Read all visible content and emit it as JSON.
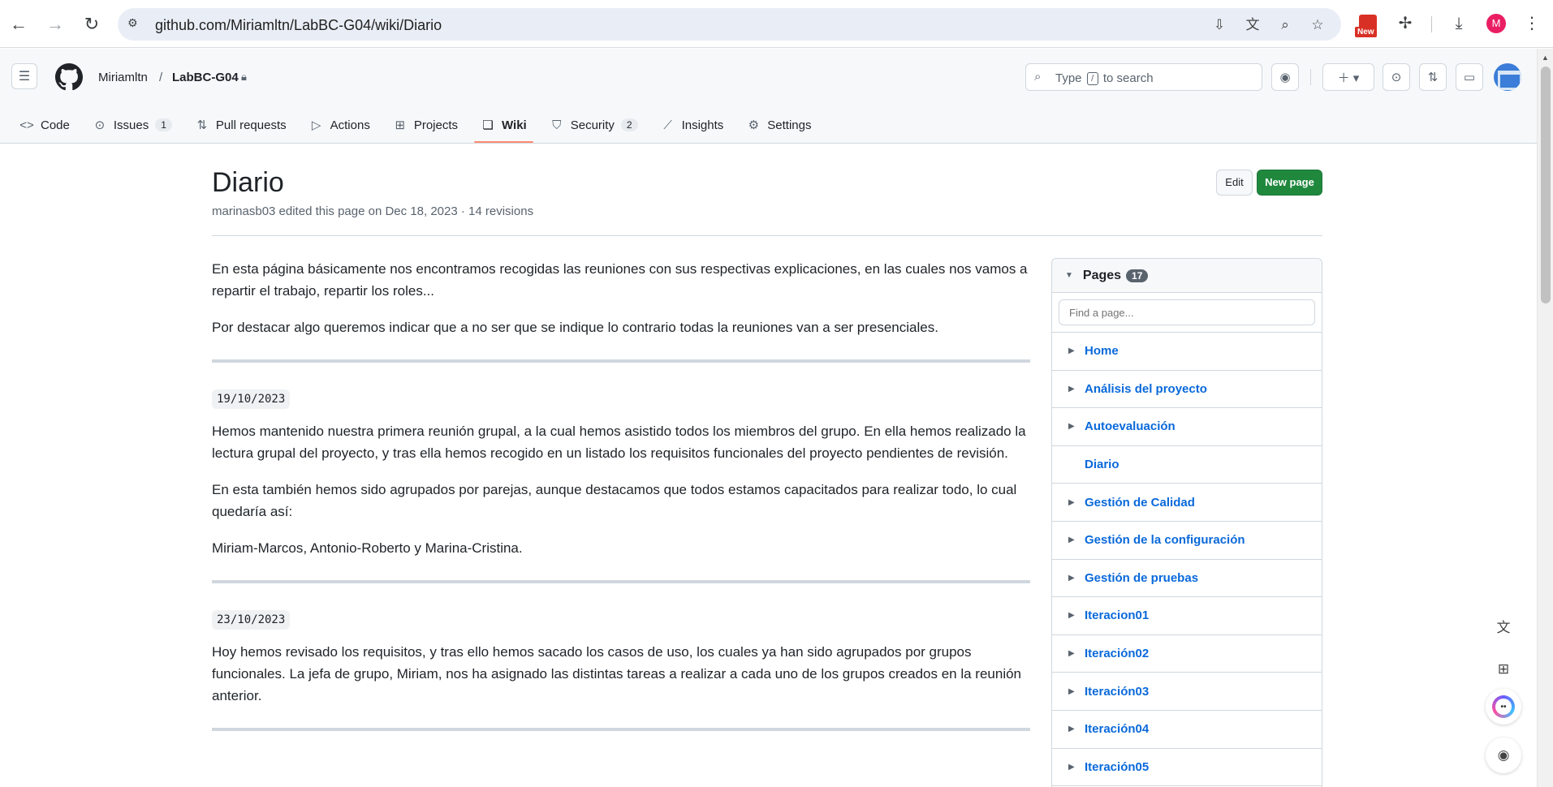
{
  "browser": {
    "url": "github.com/Miriamltn/LabBC-G04/wiki/Diario",
    "extension_badge": "New",
    "profile_initial": "M"
  },
  "header": {
    "owner": "Miriamltn",
    "separator": "/",
    "repo": "LabBC-G04",
    "search_before": "Type",
    "search_key": "/",
    "search_after": "to search"
  },
  "tabs": [
    {
      "label": "Code",
      "icon": "code-icon"
    },
    {
      "label": "Issues",
      "icon": "issue-icon",
      "count": "1"
    },
    {
      "label": "Pull requests",
      "icon": "pull-request-icon"
    },
    {
      "label": "Actions",
      "icon": "play-icon"
    },
    {
      "label": "Projects",
      "icon": "table-icon"
    },
    {
      "label": "Wiki",
      "icon": "book-icon",
      "active": true
    },
    {
      "label": "Security",
      "icon": "shield-icon",
      "count": "2"
    },
    {
      "label": "Insights",
      "icon": "graph-icon"
    },
    {
      "label": "Settings",
      "icon": "gear-icon"
    }
  ],
  "page": {
    "title": "Diario",
    "meta": "marinasb03 edited this page on Dec 18, 2023 · 14 revisions",
    "edit_label": "Edit",
    "new_page_label": "New page"
  },
  "content": {
    "intro1": "En esta página básicamente nos encontramos recogidas las reuniones con sus respectivas explicaciones, en las cuales nos vamos a repartir el trabajo, repartir los roles...",
    "intro2": "Por destacar algo queremos indicar que a no ser que se indique lo contrario todas la reuniones van a ser presenciales.",
    "date1": "19/10/2023",
    "p1": "Hemos mantenido nuestra primera reunión grupal, a la cual hemos asistido todos los miembros del grupo. En ella hemos realizado la lectura grupal del proyecto, y tras ella hemos recogido en un listado los requisitos funcionales del proyecto pendientes de revisión.",
    "p2": "En esta también hemos sido agrupados por parejas, aunque destacamos que todos estamos capacitados para realizar todo, lo cual quedaría así:",
    "p3": "Miriam-Marcos, Antonio-Roberto y Marina-Cristina.",
    "date2": "23/10/2023",
    "p4": "Hoy hemos revisado los requisitos, y tras ello hemos sacado los casos de uso, los cuales ya han sido agrupados por grupos funcionales. La jefa de grupo, Miriam, nos ha asignado las distintas tareas a realizar a cada uno de los grupos creados en la reunión anterior."
  },
  "sidebar": {
    "title": "Pages",
    "count": "17",
    "find_placeholder": "Find a page...",
    "items": [
      {
        "label": "Home",
        "expandable": true
      },
      {
        "label": "Análisis del proyecto",
        "expandable": true
      },
      {
        "label": "Autoevaluación",
        "expandable": true
      },
      {
        "label": "Diario",
        "expandable": false
      },
      {
        "label": "Gestión de Calidad",
        "expandable": true
      },
      {
        "label": "Gestión de la configuración",
        "expandable": true
      },
      {
        "label": "Gestión de pruebas",
        "expandable": true
      },
      {
        "label": "Iteracion01",
        "expandable": true
      },
      {
        "label": "Iteración02",
        "expandable": true
      },
      {
        "label": "Iteración03",
        "expandable": true
      },
      {
        "label": "Iteración04",
        "expandable": true
      },
      {
        "label": "Iteración05",
        "expandable": true
      }
    ]
  },
  "colors": {
    "accent_green": "#1f883d",
    "link_blue": "#0969da",
    "tab_underline": "#fd8c73"
  }
}
